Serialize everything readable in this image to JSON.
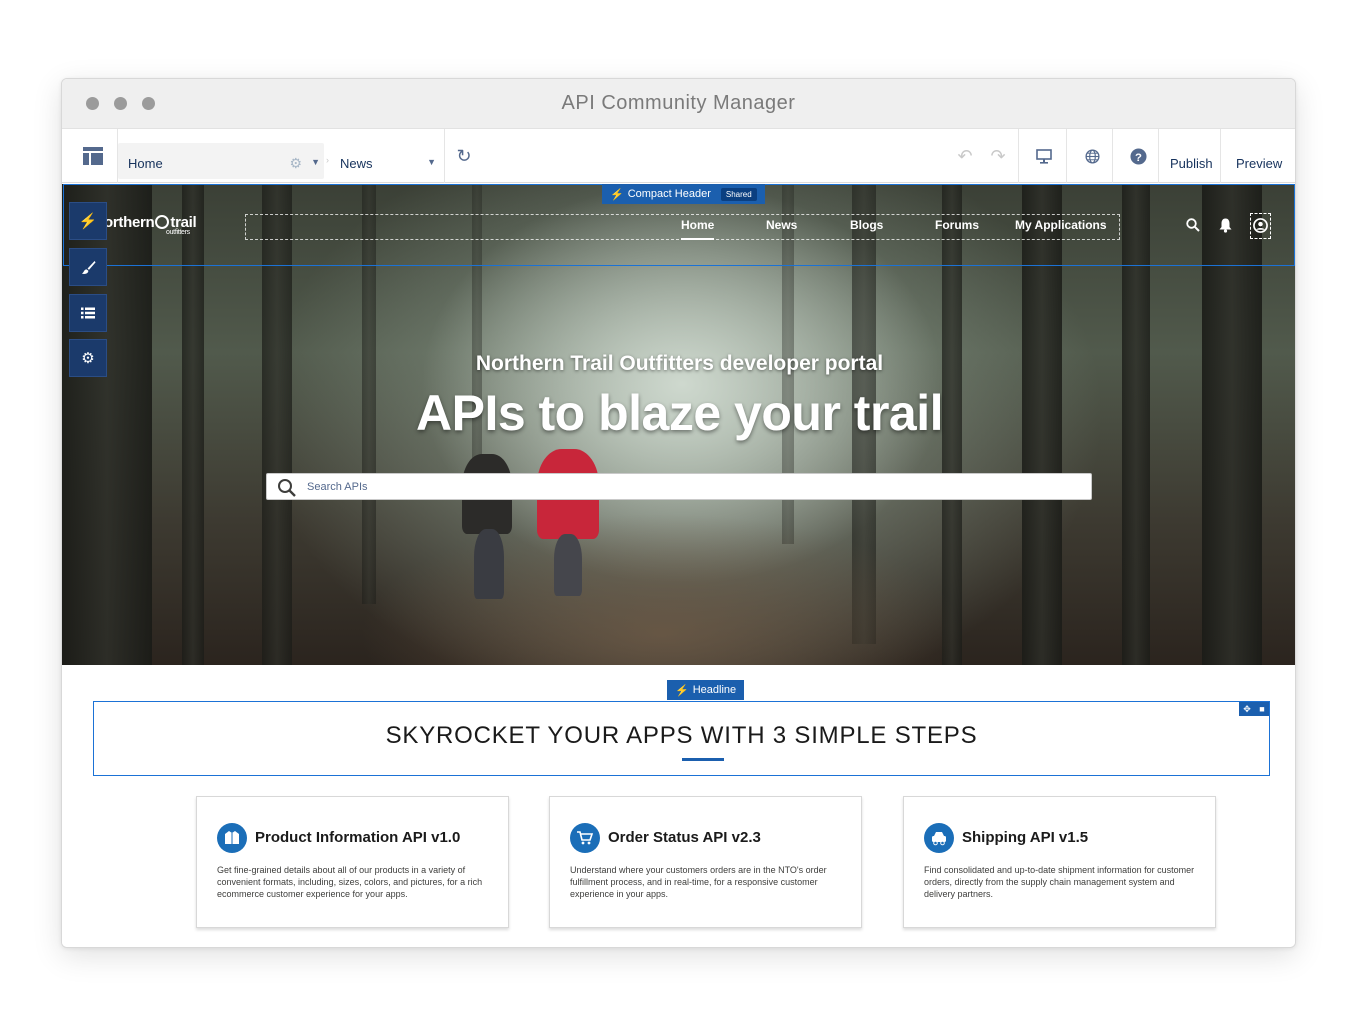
{
  "window": {
    "title": "API Community Manager"
  },
  "toolbar": {
    "page_selected": "Home",
    "news_selected": "News",
    "publish_label": "Publish",
    "preview_label": "Preview"
  },
  "compact_header": {
    "label": "Compact Header",
    "badge": "Shared"
  },
  "site_header": {
    "logo_text": "orthern",
    "logo_trail": "trail",
    "logo_sub": "outfitters",
    "nav": [
      "Home",
      "News",
      "Blogs",
      "Forums",
      "My Applications"
    ],
    "active_nav": "Home"
  },
  "hero": {
    "subtitle": "Northern Trail Outfitters developer portal",
    "title": "APIs to blaze your trail",
    "search_placeholder": "Search APIs"
  },
  "headline": {
    "tag": "Headline",
    "text": "SKYROCKET YOUR APPS WITH 3 SIMPLE STEPS"
  },
  "cards": [
    {
      "title": "Product Information API v1.0",
      "description": "Get fine-grained details about all of our products in a variety of convenient formats, including, sizes, colors, and pictures, for a rich ecommerce customer experience for your apps.",
      "icon": "jacket-icon"
    },
    {
      "title": "Order Status API v2.3",
      "description": "Understand where your customers orders are in the NTO's order fulfillment process, and in real-time, for a responsive customer experience in your apps.",
      "icon": "cart-icon"
    },
    {
      "title": "Shipping API v1.5",
      "description": "Find consolidated and up-to-date shipment information for customer orders, directly from the supply chain management system and delivery partners.",
      "icon": "delivery-icon"
    }
  ],
  "colors": {
    "accent": "#1b5fae",
    "rail": "#1b3a6b",
    "outline": "#1b72d6"
  }
}
